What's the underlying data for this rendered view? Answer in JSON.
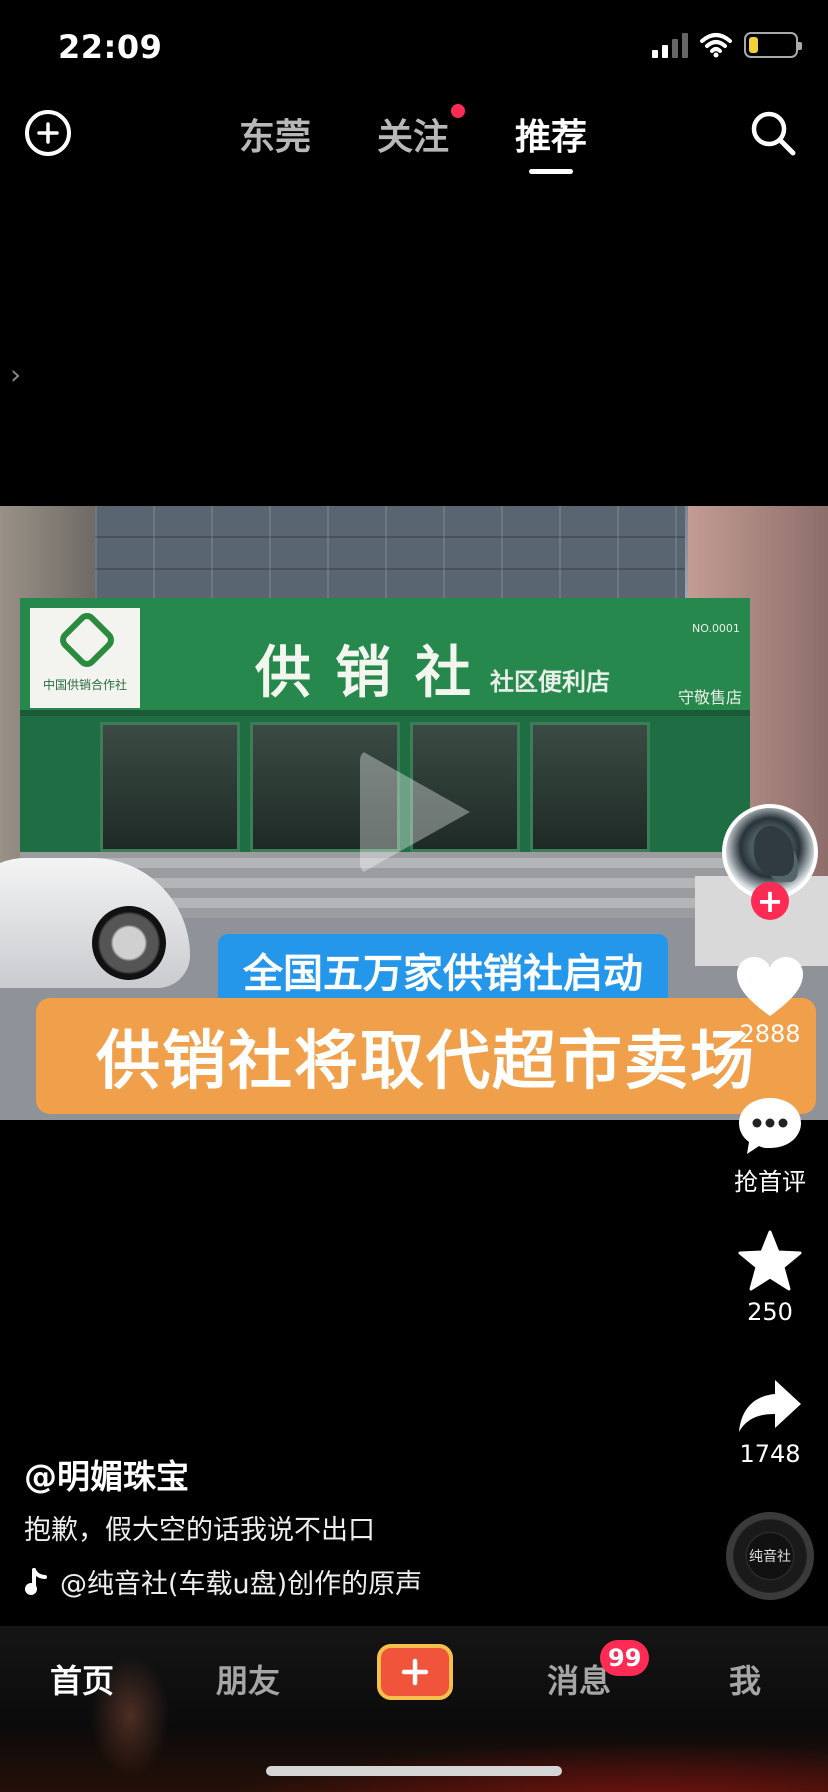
{
  "status_bar": {
    "time": "22:09",
    "battery_level": 0.2
  },
  "top_nav": {
    "tabs": [
      {
        "label": "东莞"
      },
      {
        "label": "关注"
      },
      {
        "label": "推荐"
      }
    ],
    "active_tab": "推荐"
  },
  "video": {
    "sign_title": "供销社",
    "sign_subtitle": "社区便利店",
    "sign_number": "NO.0001",
    "sign_keeper": "守敬售店",
    "logo_text": "中国供销合作社",
    "caption_top": "全国五万家供销社启动",
    "caption_main": "供销社将取代超市卖场"
  },
  "actions": {
    "likes": "2888",
    "comments": "抢首评",
    "favorites": "250",
    "shares": "1748"
  },
  "post": {
    "author": "@明媚珠宝",
    "description": "抱歉，假大空的话我说不出口",
    "music": "@纯音社(车载u盘)创作的原声",
    "disc_text": "纯音社"
  },
  "bottom_nav": {
    "items": [
      {
        "label": "首页"
      },
      {
        "label": "朋友"
      },
      {
        "label": "消息"
      },
      {
        "label": "我"
      }
    ],
    "message_badge": "99"
  },
  "colors": {
    "accent_red": "#fe2c55",
    "bg": "#000000"
  }
}
